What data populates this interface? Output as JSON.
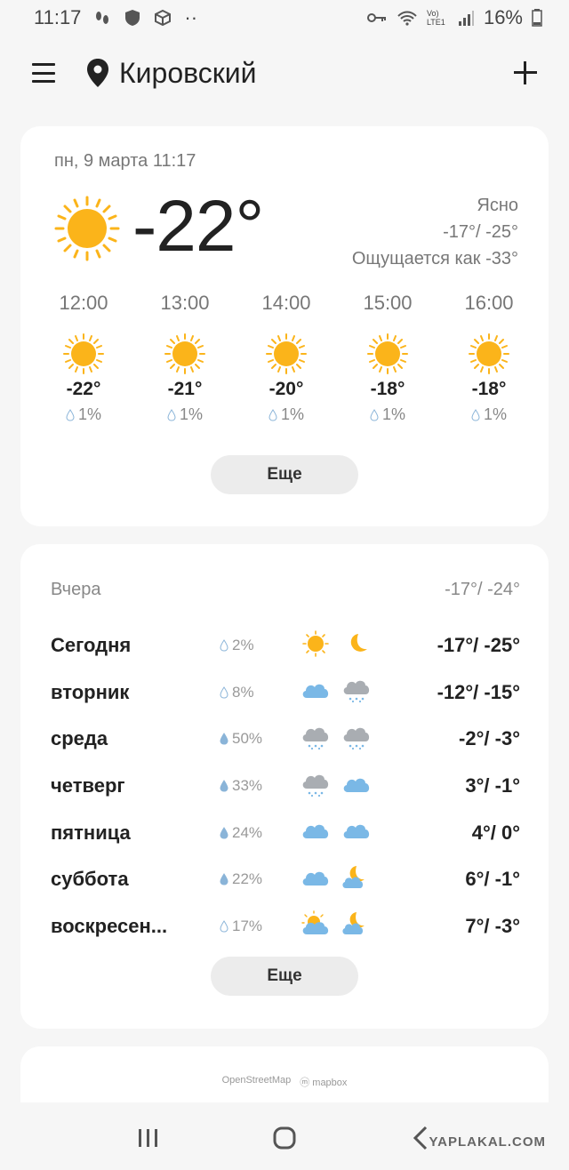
{
  "status_bar": {
    "time": "11:17",
    "dots": "··",
    "network": "Vo) LTE1",
    "battery": "16%"
  },
  "header": {
    "city": "Кировский"
  },
  "current": {
    "date": "пн, 9 марта 11:17",
    "temp": "-22°",
    "condition": "Ясно",
    "high_low": "-17°/ -25°",
    "feels_like": "Ощущается как -33°",
    "sun_color": "#fbb41a"
  },
  "hourly": [
    {
      "time": "12:00",
      "temp": "-22°",
      "precip": "1%"
    },
    {
      "time": "13:00",
      "temp": "-21°",
      "precip": "1%"
    },
    {
      "time": "14:00",
      "temp": "-20°",
      "precip": "1%"
    },
    {
      "time": "15:00",
      "temp": "-18°",
      "precip": "1%"
    },
    {
      "time": "16:00",
      "temp": "-18°",
      "precip": "1%"
    }
  ],
  "buttons": {
    "more_hourly": "Еще",
    "more_daily": "Еще"
  },
  "yesterday": {
    "label": "Вчера",
    "range": "-17°/ -24°"
  },
  "daily": [
    {
      "day": "Сегодня",
      "precip": "2%",
      "day_icon": "sun-icon",
      "night_icon": "moon-icon",
      "range": "-17°/ -25°"
    },
    {
      "day": "вторник",
      "precip": "8%",
      "day_icon": "cloud-icon",
      "night_icon": "snow-cloud-icon",
      "range": "-12°/ -15°"
    },
    {
      "day": "среда",
      "precip": "50%",
      "day_icon": "snow-cloud-icon",
      "night_icon": "snow-cloud-icon",
      "range": "-2°/ -3°"
    },
    {
      "day": "четверг",
      "precip": "33%",
      "day_icon": "snow-cloud-icon",
      "night_icon": "cloud-icon",
      "range": "3°/ -1°"
    },
    {
      "day": "пятница",
      "precip": "24%",
      "day_icon": "cloud-icon",
      "night_icon": "cloud-icon",
      "range": "4°/ 0°"
    },
    {
      "day": "суббота",
      "precip": "22%",
      "day_icon": "cloud-icon",
      "night_icon": "moon-cloud-icon",
      "range": "6°/ -1°"
    },
    {
      "day": "воскресен...",
      "precip": "17%",
      "day_icon": "sun-cloud-icon",
      "night_icon": "moon-cloud-icon",
      "range": "7°/ -3°"
    }
  ],
  "map": {
    "osm": "OpenStreetMap",
    "mapbox": "mapbox"
  },
  "watermark": "YAPLAKAL.COM"
}
